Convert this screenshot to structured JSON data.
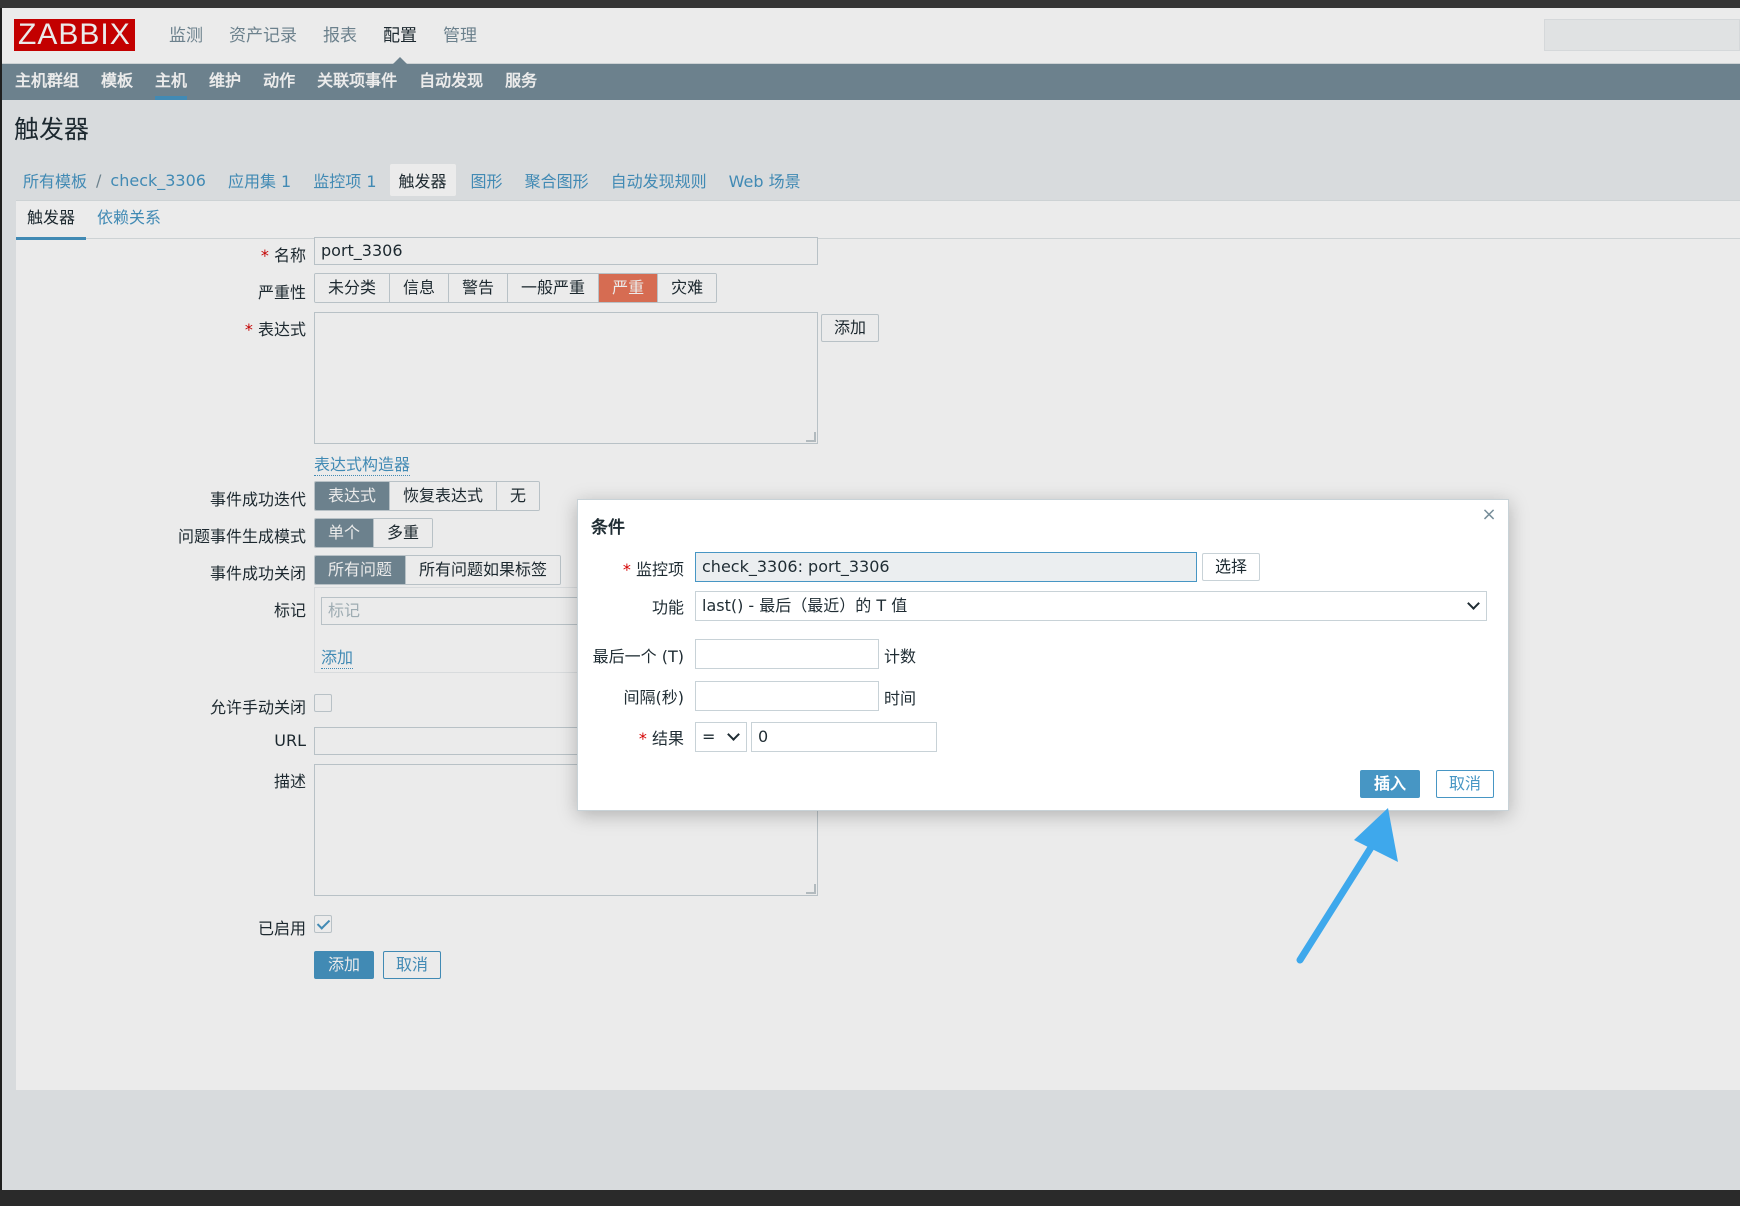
{
  "brand": {
    "logo": "ZABBIX"
  },
  "top_nav": [
    {
      "label": "监测",
      "active": false
    },
    {
      "label": "资产记录",
      "active": false
    },
    {
      "label": "报表",
      "active": false
    },
    {
      "label": "配置",
      "active": true
    },
    {
      "label": "管理",
      "active": false
    }
  ],
  "sub_nav": [
    {
      "label": "主机群组",
      "active": false
    },
    {
      "label": "模板",
      "active": false
    },
    {
      "label": "主机",
      "active": true
    },
    {
      "label": "维护",
      "active": false
    },
    {
      "label": "动作",
      "active": false
    },
    {
      "label": "关联项事件",
      "active": false
    },
    {
      "label": "自动发现",
      "active": false
    },
    {
      "label": "服务",
      "active": false
    }
  ],
  "page": {
    "title": "触发器"
  },
  "breadcrumbs": {
    "all_templates": "所有模板",
    "separator": "/",
    "template": "check_3306",
    "applications": "应用集 1",
    "items": "监控项 1",
    "triggers": "触发器",
    "graphs": "图形",
    "screens": "聚合图形",
    "discovery": "自动发现规则",
    "web": "Web 场景"
  },
  "tabs": {
    "trigger": "触发器",
    "dependencies": "依赖关系"
  },
  "form": {
    "name_label": "名称",
    "name_value": "port_3306",
    "severity_label": "严重性",
    "severity_options": [
      "未分类",
      "信息",
      "警告",
      "一般严重",
      "严重",
      "灾难"
    ],
    "severity_selected": "严重",
    "expression_label": "表达式",
    "expression_add": "添加",
    "expression_builder": "表达式构造器",
    "ok_event_label": "事件成功迭代",
    "ok_event_options": [
      "表达式",
      "恢复表达式",
      "无"
    ],
    "problem_mode_label": "问题事件生成模式",
    "problem_mode_options": [
      "单个",
      "多重"
    ],
    "ok_close_label": "事件成功关闭",
    "ok_close_options": [
      "所有问题",
      "所有问题如果标签"
    ],
    "tags_label": "标记",
    "tags_placeholder": "标记",
    "tags_add": "添加",
    "manual_close_label": "允许手动关闭",
    "url_label": "URL",
    "description_label": "描述",
    "enabled_label": "已启用",
    "enabled": true,
    "submit": "添加",
    "cancel": "取消"
  },
  "dialog": {
    "title": "条件",
    "item_label": "监控项",
    "item_value": "check_3306: port_3306",
    "select_button": "选择",
    "function_label": "功能",
    "function_value": "last() - 最后（最近）的 T 值",
    "last_label": "最后一个 (T)",
    "last_unit": "计数",
    "interval_label": "间隔(秒)",
    "interval_unit": "时间",
    "result_label": "结果",
    "result_operator": "=",
    "result_value": "0",
    "insert": "插入",
    "cancel": "取消"
  },
  "colors": {
    "accent": "#4796c4",
    "subnav_bg": "#768d99",
    "severity_high": "#e97659",
    "logo_bg": "#d40000",
    "annotation_arrow": "#3ea8ec"
  }
}
